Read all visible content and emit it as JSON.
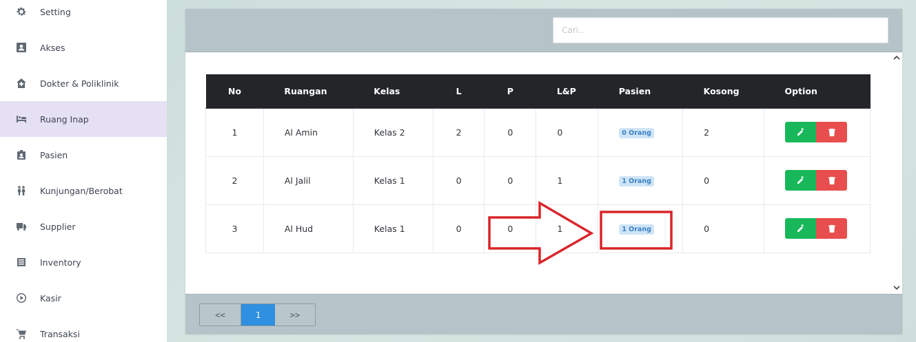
{
  "sidebar": {
    "items": [
      {
        "label": "Setting",
        "icon": "gear-icon"
      },
      {
        "label": "Akses",
        "icon": "id-card-icon"
      },
      {
        "label": "Dokter & Poliklinik",
        "icon": "clinic-icon"
      },
      {
        "label": "Ruang Inap",
        "icon": "bed-icon",
        "active": true
      },
      {
        "label": "Pasien",
        "icon": "patient-badge-icon"
      },
      {
        "label": "Kunjungan/Berobat",
        "icon": "people-icon"
      },
      {
        "label": "Supplier",
        "icon": "truck-icon"
      },
      {
        "label": "Inventory",
        "icon": "list-icon"
      },
      {
        "label": "Kasir",
        "icon": "play-circle-icon"
      },
      {
        "label": "Transaksi",
        "icon": "cart-icon"
      }
    ]
  },
  "search": {
    "placeholder": "Cari.."
  },
  "table": {
    "headers": {
      "no": "No",
      "ruangan": "Ruangan",
      "kelas": "Kelas",
      "l": "L",
      "p": "P",
      "lp": "L&P",
      "pasien": "Pasien",
      "kosong": "Kosong",
      "option": "Option"
    },
    "rows": [
      {
        "no": "1",
        "ruangan": "Al Amin",
        "kelas": "Kelas 2",
        "l": "2",
        "p": "0",
        "lp": "0",
        "pasien": "0 Orang",
        "kosong": "2"
      },
      {
        "no": "2",
        "ruangan": "Al Jalil",
        "kelas": "Kelas 1",
        "l": "0",
        "p": "0",
        "lp": "1",
        "pasien": "1 Orang",
        "kosong": "0"
      },
      {
        "no": "3",
        "ruangan": "Al Hud",
        "kelas": "Kelas 1",
        "l": "0",
        "p": "0",
        "lp": "1",
        "pasien": "1 Orang",
        "kosong": "0"
      }
    ]
  },
  "pagination": {
    "prev": "<<",
    "current": "1",
    "next": ">>"
  },
  "colors": {
    "accent_active": "#e6e0f5",
    "edit_button": "#18b85a",
    "delete_button": "#e84e4e",
    "annotation": "#d9252a",
    "current_page": "#2f8fe0"
  }
}
